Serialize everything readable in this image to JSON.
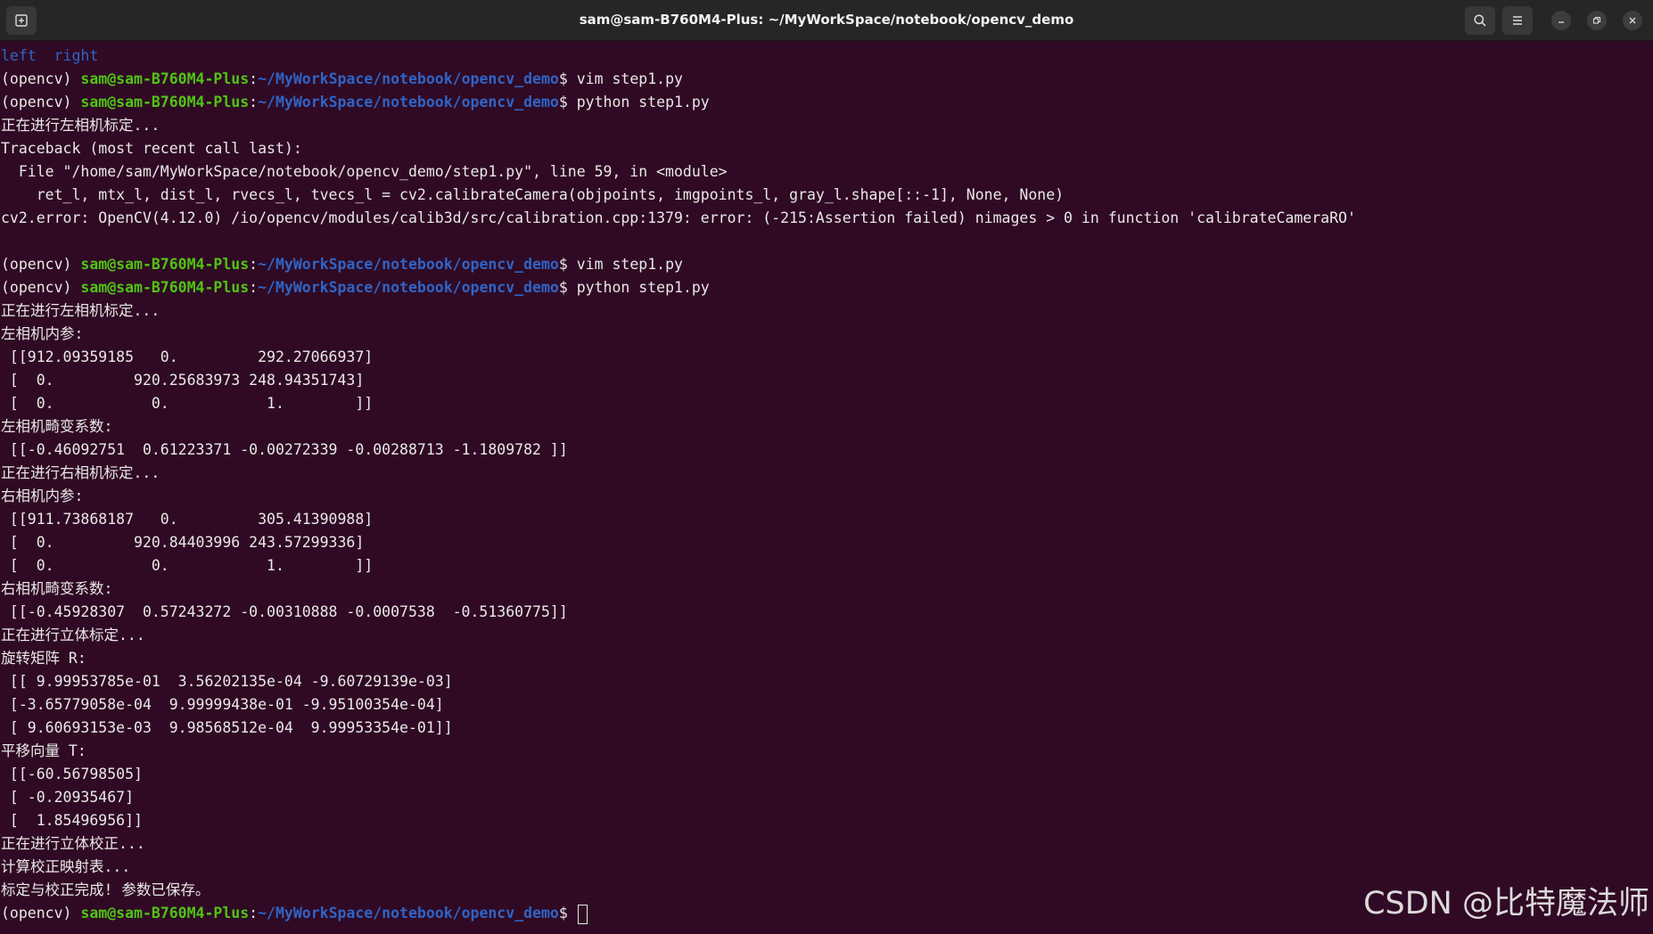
{
  "window": {
    "title": "sam@sam-B760M4-Plus: ~/MyWorkSpace/notebook/opencv_demo"
  },
  "icons": {
    "new_tab": "new-tab-icon",
    "search": "search-icon",
    "menu": "hamburger-menu-icon",
    "minimize": "minimize-icon",
    "maximize": "restore-icon",
    "close": "close-icon"
  },
  "colors": {
    "background": "#300a24",
    "prompt_user": "#4fc414",
    "prompt_path": "#2f64c6",
    "text": "#e8e8e8"
  },
  "prompt": {
    "env": "(opencv) ",
    "user": "sam@sam-B760M4-Plus",
    "colon": ":",
    "path": "~/MyWorkSpace/notebook/opencv_demo",
    "symbol": "$ "
  },
  "terminal": {
    "line_01": "left  right",
    "cmd_02": "vim step1.py",
    "cmd_03": "python step1.py",
    "line_04": "正在进行左相机标定...",
    "line_05": "Traceback (most recent call last):",
    "line_06": "  File \"/home/sam/MyWorkSpace/notebook/opencv_demo/step1.py\", line 59, in <module>",
    "line_07": "    ret_l, mtx_l, dist_l, rvecs_l, tvecs_l = cv2.calibrateCamera(objpoints, imgpoints_l, gray_l.shape[::-1], None, None)",
    "line_08": "cv2.error: OpenCV(4.12.0) /io/opencv/modules/calib3d/src/calibration.cpp:1379: error: (-215:Assertion failed) nimages > 0 in function 'calibrateCameraRO'",
    "cmd_10": "vim step1.py",
    "cmd_11": "python step1.py",
    "line_12": "正在进行左相机标定...",
    "line_13": "左相机内参:",
    "line_14": " [[912.09359185   0.         292.27066937]",
    "line_15": " [  0.         920.25683973 248.94351743]",
    "line_16": " [  0.           0.           1.        ]]",
    "line_17": "左相机畸变系数:",
    "line_18": " [[-0.46092751  0.61223371 -0.00272339 -0.00288713 -1.1809782 ]]",
    "line_19": "正在进行右相机标定...",
    "line_20": "右相机内参:",
    "line_21": " [[911.73868187   0.         305.41390988]",
    "line_22": " [  0.         920.84403996 243.57299336]",
    "line_23": " [  0.           0.           1.        ]]",
    "line_24": "右相机畸变系数:",
    "line_25": " [[-0.45928307  0.57243272 -0.00310888 -0.0007538  -0.51360775]]",
    "line_26": "正在进行立体标定...",
    "line_27": "旋转矩阵 R:",
    "line_28": " [[ 9.99953785e-01  3.56202135e-04 -9.60729139e-03]",
    "line_29": " [-3.65779058e-04  9.99999438e-01 -9.95100354e-04]",
    "line_30": " [ 9.60693153e-03  9.98568512e-04  9.99953354e-01]]",
    "line_31": "平移向量 T:",
    "line_32": " [[-60.56798505]",
    "line_33": " [ -0.20935467]",
    "line_34": " [  1.85496956]]",
    "line_35": "正在进行立体校正...",
    "line_36": "计算校正映射表...",
    "line_37": "标定与校正完成! 参数已保存。"
  },
  "watermark": "CSDN @比特魔法师"
}
